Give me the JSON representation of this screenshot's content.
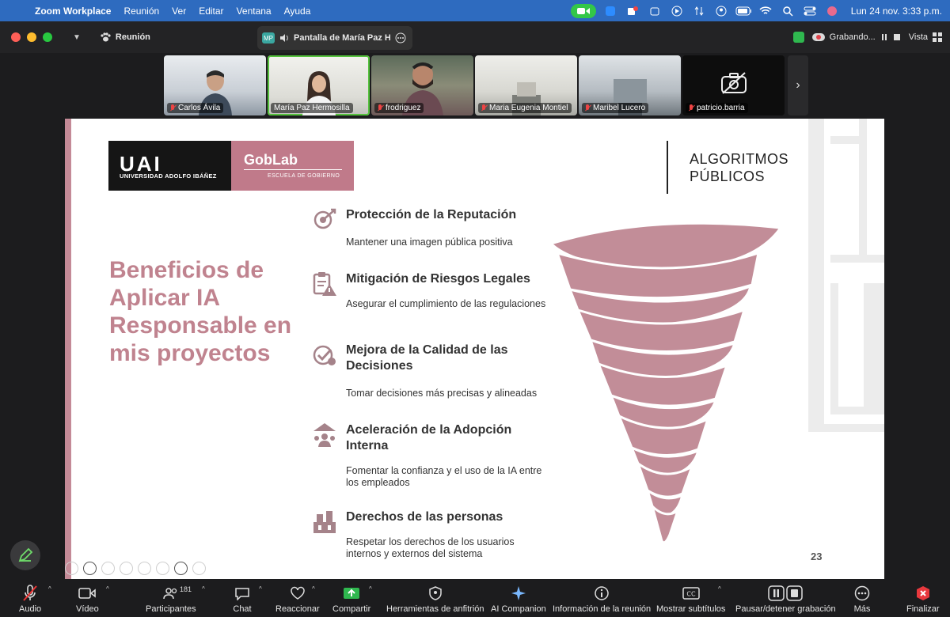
{
  "menubar": {
    "app_name": "Zoom Workplace",
    "menus": [
      "Reunión",
      "Ver",
      "Editar",
      "Ventana",
      "Ayuda"
    ],
    "clock": "Lun 24 nov.  3:33 p.m."
  },
  "titlebar": {
    "meeting_label": "Reunión",
    "share_initials": "MP",
    "share_tab_label": "Pantalla de María Paz Her",
    "recording_label": "Grabando...",
    "view_label": "Vista"
  },
  "participants": [
    {
      "name": "Carlos Ávila",
      "muted": true,
      "active": false
    },
    {
      "name": "María Paz Hermosilla",
      "muted": false,
      "active": true
    },
    {
      "name": "frodriguez",
      "muted": true,
      "active": false
    },
    {
      "name": "Maria Eugenia Montiel",
      "muted": true,
      "active": false
    },
    {
      "name": "Maribel Lucero",
      "muted": true,
      "active": false
    },
    {
      "name": "patricio.barria",
      "muted": true,
      "active": false
    }
  ],
  "slide": {
    "uai_big": "UAI",
    "uai_small": "UNIVERSIDAD ADOLFO IBÁÑEZ",
    "goblab_big": "GobLab",
    "goblab_small": "ESCUELA DE GOBIERNO",
    "algo_line1": "ALGORITMOS",
    "algo_line2": "PÚBLICOS",
    "title": "Beneficios de Aplicar IA Responsable en mis proyectos",
    "benefits": [
      {
        "title": "Protección de la Reputación",
        "desc": "Mantener una imagen pública positiva"
      },
      {
        "title": "Mitigación de Riesgos Legales",
        "desc": "Asegurar el cumplimiento de las regulaciones"
      },
      {
        "title": "Mejora de la Calidad de las Decisiones",
        "desc": "Tomar decisiones más precisas y alineadas"
      },
      {
        "title": "Aceleración de la Adopción Interna",
        "desc": "Fomentar la confianza y el uso de la IA entre los empleados"
      },
      {
        "title": "Derechos de las personas",
        "desc": "Respetar los derechos de los usuarios internos y externos del sistema"
      }
    ],
    "page_number": "23",
    "accent_color": "#c0838f"
  },
  "toolbar": {
    "audio": "Audio",
    "video": "Vídeo",
    "participants": "Participantes",
    "participant_count": "181",
    "chat": "Chat",
    "react": "Reaccionar",
    "share": "Compartir",
    "host_tools": "Herramientas de anfitrión",
    "ai_companion": "AI Companion",
    "meeting_info": "Información de la reunión",
    "captions": "Mostrar subtítulos",
    "pause_recording": "Pausar/detener grabación",
    "more": "Más",
    "end": "Finalizar"
  }
}
